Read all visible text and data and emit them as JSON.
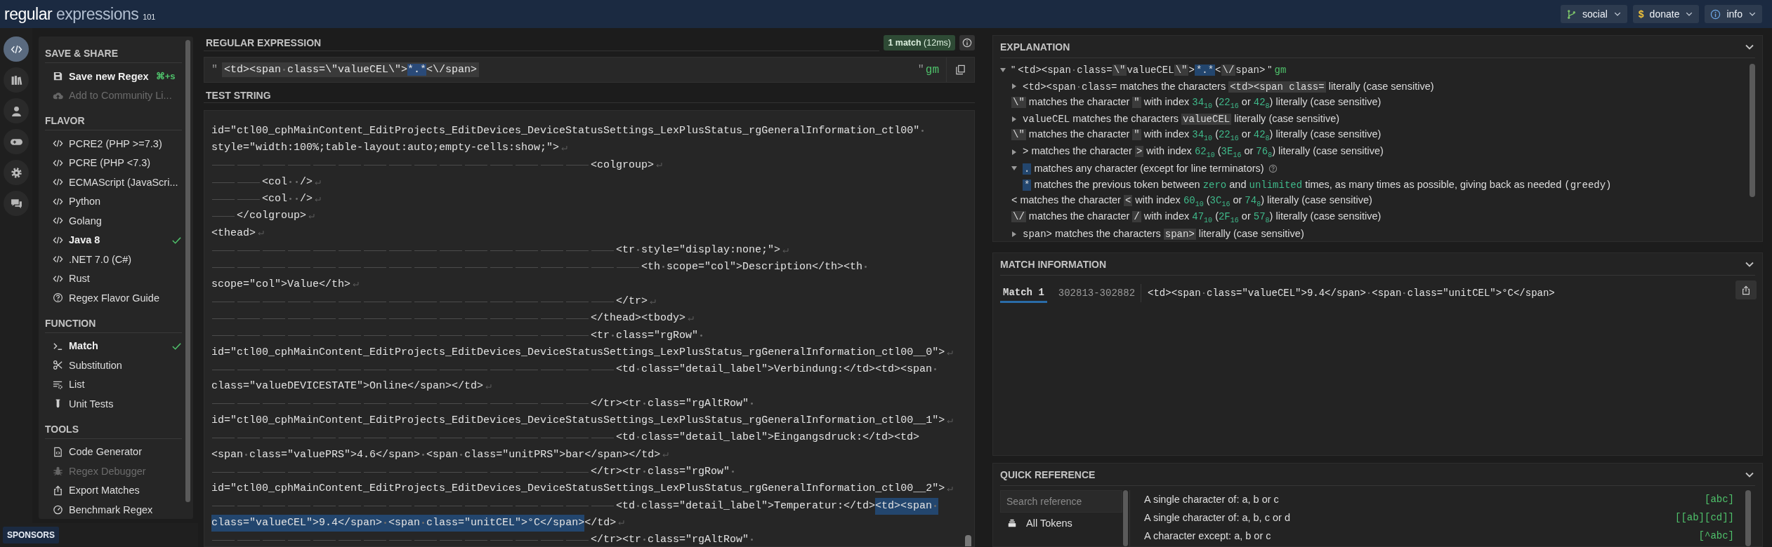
{
  "header": {
    "logo": [
      "regular",
      "expressions",
      "101"
    ],
    "buttons": [
      {
        "label": "social"
      },
      {
        "label": "donate",
        "glyph": "$"
      },
      {
        "label": "info"
      }
    ]
  },
  "rail": [
    {
      "selected": true
    },
    {
      "selected": false
    },
    {
      "selected": false
    },
    {
      "selected": false
    },
    {
      "selected": false
    },
    {
      "selected": false
    }
  ],
  "sidebar": {
    "sections": [
      {
        "title": "SAVE & SHARE",
        "items": [
          {
            "label": "Save new Regex",
            "shortcut": "⌘+s",
            "disabled": false
          },
          {
            "label": "Add to Community Li...",
            "disabled": true
          }
        ]
      },
      {
        "title": "FLAVOR",
        "items": [
          {
            "label": "PCRE2 (PHP >=7.3)",
            "selected": false,
            "disabled": false
          },
          {
            "label": "PCRE (PHP <7.3)",
            "selected": false,
            "disabled": false
          },
          {
            "label": "ECMAScript (JavaScri...",
            "selected": false,
            "disabled": false
          },
          {
            "label": "Python",
            "selected": false,
            "disabled": false
          },
          {
            "label": "Golang",
            "selected": false,
            "disabled": false
          },
          {
            "label": "Java 8",
            "selected": true,
            "disabled": false
          },
          {
            "label": ".NET 7.0 (C#)",
            "selected": false,
            "disabled": false
          },
          {
            "label": "Rust",
            "selected": false,
            "disabled": false
          },
          {
            "label": "Regex Flavor Guide",
            "selected": false,
            "disabled": false
          }
        ]
      },
      {
        "title": "FUNCTION",
        "items": [
          {
            "label": "Match",
            "selected": true,
            "disabled": false
          },
          {
            "label": "Substitution",
            "selected": false,
            "disabled": false
          },
          {
            "label": "List",
            "selected": false,
            "disabled": false
          },
          {
            "label": "Unit Tests",
            "selected": false,
            "disabled": false
          }
        ]
      },
      {
        "title": "TOOLS",
        "items": [
          {
            "label": "Code Generator",
            "selected": false,
            "disabled": false
          },
          {
            "label": "Regex Debugger",
            "selected": false,
            "disabled": true
          },
          {
            "label": "Export Matches",
            "selected": false,
            "disabled": false
          },
          {
            "label": "Benchmark Regex",
            "selected": false,
            "disabled": false
          }
        ]
      }
    ]
  },
  "sponsors": "SPONSORS",
  "regex": {
    "title": "REGULAR EXPRESSION",
    "badge": "**1 match** (12ms)",
    "delimiter_open": "\"",
    "pattern": [
      {
        "kind": "literal",
        "text": "<td><span class=\\\"valueCEL\\\">"
      },
      {
        "kind": "quantifier",
        "text": "*.*"
      },
      {
        "kind": "literal",
        "text": "<\\/span>"
      }
    ],
    "delimiter_close": "\"",
    "flags": "gm"
  },
  "test_string": {
    "title": "TEST STRING",
    "lines": [
      {
        "segments": [
          {
            "text": "id=\"ctl00_cphMainContent_EditProjects_EditDevices_DeviceStatusSettings_LexPlusStatus_rgGeneralInformation_ctl00\" ",
            "match": false
          }
        ],
        "line_break": false
      },
      {
        "segments": [
          {
            "text": "style=\"width:100%;table-layout:auto;empty-cells:show;\">",
            "match": false
          }
        ],
        "line_break": true
      },
      {
        "segments": [
          {
            "text": "\t\t\t\t\t\t\t\t\t\t\t\t\t\t\t<colgroup>",
            "match": false
          }
        ],
        "line_break": true
      },
      {
        "segments": [
          {
            "text": "\t\t<col  />",
            "match": false
          }
        ],
        "line_break": true
      },
      {
        "segments": [
          {
            "text": "\t\t<col  />",
            "match": false
          }
        ],
        "line_break": true
      },
      {
        "segments": [
          {
            "text": "\t</colgroup>",
            "match": false
          }
        ],
        "line_break": true
      },
      {
        "segments": [
          {
            "text": "<thead>",
            "match": false
          }
        ],
        "line_break": true
      },
      {
        "segments": [
          {
            "text": "\t\t\t\t\t\t\t\t\t\t\t\t\t\t\t\t<tr style=\"display:none;\">",
            "match": false
          }
        ],
        "line_break": true
      },
      {
        "segments": [
          {
            "text": "\t\t\t\t\t\t\t\t\t\t\t\t\t\t\t\t\t<th scope=\"col\">Description</th><th ",
            "match": false
          }
        ],
        "line_break": false
      },
      {
        "segments": [
          {
            "text": "scope=\"col\">Value</th>",
            "match": false
          }
        ],
        "line_break": true
      },
      {
        "segments": [
          {
            "text": "\t\t\t\t\t\t\t\t\t\t\t\t\t\t\t\t</tr>",
            "match": false
          }
        ],
        "line_break": true
      },
      {
        "segments": [
          {
            "text": "\t\t\t\t\t\t\t\t\t\t\t\t\t\t\t</thead><tbody>",
            "match": false
          }
        ],
        "line_break": true
      },
      {
        "segments": [
          {
            "text": "\t\t\t\t\t\t\t\t\t\t\t\t\t\t\t<tr class=\"rgRow\" ",
            "match": false
          }
        ],
        "line_break": false
      },
      {
        "segments": [
          {
            "text": "id=\"ctl00_cphMainContent_EditProjects_EditDevices_DeviceStatusSettings_LexPlusStatus_rgGeneralInformation_ctl00__0\">",
            "match": false
          }
        ],
        "line_break": true
      },
      {
        "segments": [
          {
            "text": "\t\t\t\t\t\t\t\t\t\t\t\t\t\t\t\t<td class=\"detail_label\">Verbindung:</td><td><span ",
            "match": false
          }
        ],
        "line_break": false
      },
      {
        "segments": [
          {
            "text": "class=\"valueDEVICESTATE\">Online</span></td>",
            "match": false
          }
        ],
        "line_break": true
      },
      {
        "segments": [
          {
            "text": "\t\t\t\t\t\t\t\t\t\t\t\t\t\t\t</tr><tr class=\"rgAltRow\" ",
            "match": false
          }
        ],
        "line_break": false
      },
      {
        "segments": [
          {
            "text": "id=\"ctl00_cphMainContent_EditProjects_EditDevices_DeviceStatusSettings_LexPlusStatus_rgGeneralInformation_ctl00__1\">",
            "match": false
          }
        ],
        "line_break": true
      },
      {
        "segments": [
          {
            "text": "\t\t\t\t\t\t\t\t\t\t\t\t\t\t\t\t<td class=\"detail_label\">Eingangsdruck:</td><td>",
            "match": false
          }
        ],
        "line_break": false
      },
      {
        "segments": [
          {
            "text": "<span class=\"valuePRS\">4.6</span> <span class=\"unitPRS\">bar</span></td>",
            "match": false
          }
        ],
        "line_break": true
      },
      {
        "segments": [
          {
            "text": "\t\t\t\t\t\t\t\t\t\t\t\t\t\t\t</tr><tr class=\"rgRow\" ",
            "match": false
          }
        ],
        "line_break": false
      },
      {
        "segments": [
          {
            "text": "id=\"ctl00_cphMainContent_EditProjects_EditDevices_DeviceStatusSettings_LexPlusStatus_rgGeneralInformation_ctl00__2\">",
            "match": false
          }
        ],
        "line_break": true
      },
      {
        "segments": [
          {
            "text": "\t\t\t\t\t\t\t\t\t\t\t\t\t\t\t\t<td class=\"detail_label\">Temperatur:</td>",
            "match": false
          },
          {
            "text": "<td><span ",
            "match": true
          }
        ],
        "line_break": false
      },
      {
        "segments": [
          {
            "text": "class=\"valueCEL\">9.4</span> <span class=\"unitCEL\">°C</span>",
            "match": true
          },
          {
            "text": "</td>",
            "match": false
          }
        ],
        "line_break": true
      },
      {
        "segments": [
          {
            "text": "\t\t\t\t\t\t\t\t\t\t\t\t\t\t\t</tr><tr class=\"rgAltRow\" ",
            "match": false
          }
        ],
        "line_break": false
      }
    ]
  },
  "explanation": {
    "title": "EXPLANATION",
    "rows": [
      {
        "expanded": true,
        "parts": [
          {
            "kind": "text",
            "text": "\" "
          },
          {
            "kind": "token",
            "text": "<td><span class="
          },
          {
            "kind": "code",
            "text": "\\\""
          },
          {
            "kind": "token",
            "text": "valueCEL"
          },
          {
            "kind": "code",
            "text": "\\\""
          },
          {
            "kind": "token",
            "text": ">"
          },
          {
            "kind": "hl",
            "text": "*.*"
          },
          {
            "kind": "token",
            "text": "<"
          },
          {
            "kind": "code",
            "text": "\\/"
          },
          {
            "kind": "token",
            "text": "span>"
          },
          {
            "kind": "text",
            "text": " \" "
          },
          {
            "kind": "flag",
            "text": "gm"
          }
        ],
        "children": [
          {
            "expanded": false,
            "parts": [
              {
                "kind": "token",
                "text": "<td><span class="
              },
              {
                "kind": "text",
                "text": " matches the characters "
              },
              {
                "kind": "code",
                "text": "<td><span class="
              },
              {
                "kind": "text",
                "text": " literally (case sensitive)"
              }
            ]
          },
          {
            "parts": [
              {
                "kind": "code",
                "text": "\\\""
              },
              {
                "kind": "text",
                "text": " matches the character "
              },
              {
                "kind": "code",
                "text": "\""
              },
              {
                "kind": "text",
                "text": " with index "
              },
              {
                "kind": "num",
                "text": "34$_{10}$"
              },
              {
                "kind": "text",
                "text": " ("
              },
              {
                "kind": "num",
                "text": "22$_{16}$"
              },
              {
                "kind": "text",
                "text": " or "
              },
              {
                "kind": "num",
                "text": "42$_{8}$"
              },
              {
                "kind": "text",
                "text": ") literally (case sensitive)"
              }
            ]
          },
          {
            "expanded": false,
            "parts": [
              {
                "kind": "token",
                "text": "valueCEL"
              },
              {
                "kind": "text",
                "text": " matches the characters "
              },
              {
                "kind": "code",
                "text": "valueCEL"
              },
              {
                "kind": "text",
                "text": " literally (case sensitive)"
              }
            ]
          },
          {
            "parts": [
              {
                "kind": "code",
                "text": "\\\""
              },
              {
                "kind": "text",
                "text": " matches the character "
              },
              {
                "kind": "code",
                "text": "\""
              },
              {
                "kind": "text",
                "text": " with index "
              },
              {
                "kind": "num",
                "text": "34$_{10}$"
              },
              {
                "kind": "text",
                "text": " ("
              },
              {
                "kind": "num",
                "text": "22$_{16}$"
              },
              {
                "kind": "text",
                "text": " or "
              },
              {
                "kind": "num",
                "text": "42$_{8}$"
              },
              {
                "kind": "text",
                "text": ") literally (case sensitive)"
              }
            ]
          },
          {
            "expanded": false,
            "parts": [
              {
                "kind": "token",
                "text": ">"
              },
              {
                "kind": "text",
                "text": " matches the character "
              },
              {
                "kind": "code",
                "text": ">"
              },
              {
                "kind": "text",
                "text": " with index "
              },
              {
                "kind": "num",
                "text": "62$_{10}$"
              },
              {
                "kind": "text",
                "text": " ("
              },
              {
                "kind": "num",
                "text": "3E$_{16}$"
              },
              {
                "kind": "text",
                "text": " or "
              },
              {
                "kind": "num",
                "text": "76$_{8}$"
              },
              {
                "kind": "text",
                "text": ") literally (case sensitive)"
              }
            ]
          },
          {
            "expanded": true,
            "help": true,
            "parts": [
              {
                "kind": "hl",
                "text": "."
              },
              {
                "kind": "text",
                "text": " matches any character (except for line terminators)"
              }
            ],
            "children": [
              {
                "parts": [
                  {
                    "kind": "hl",
                    "text": "*"
                  },
                  {
                    "kind": "text",
                    "text": " matches the previous token between "
                  },
                  {
                    "kind": "num",
                    "text": "zero"
                  },
                  {
                    "kind": "text",
                    "text": " and "
                  },
                  {
                    "kind": "num",
                    "text": "unlimited"
                  },
                  {
                    "kind": "text",
                    "text": " times, as many times as possible, giving back as needed "
                  },
                  {
                    "kind": "token",
                    "text": "(greedy)"
                  }
                ]
              }
            ]
          },
          {
            "parts": [
              {
                "kind": "token",
                "text": "<"
              },
              {
                "kind": "text",
                "text": " matches the character "
              },
              {
                "kind": "code",
                "text": "<"
              },
              {
                "kind": "text",
                "text": " with index "
              },
              {
                "kind": "num",
                "text": "60$_{10}$"
              },
              {
                "kind": "text",
                "text": " ("
              },
              {
                "kind": "num",
                "text": "3C$_{16}$"
              },
              {
                "kind": "text",
                "text": " or "
              },
              {
                "kind": "num",
                "text": "74$_{8}$"
              },
              {
                "kind": "text",
                "text": ") literally (case sensitive)"
              }
            ]
          },
          {
            "parts": [
              {
                "kind": "code",
                "text": "\\/"
              },
              {
                "kind": "text",
                "text": " matches the character "
              },
              {
                "kind": "code",
                "text": "/"
              },
              {
                "kind": "text",
                "text": " with index "
              },
              {
                "kind": "num",
                "text": "47$_{10}$"
              },
              {
                "kind": "text",
                "text": " ("
              },
              {
                "kind": "num",
                "text": "2F$_{16}$"
              },
              {
                "kind": "text",
                "text": " or "
              },
              {
                "kind": "num",
                "text": "57$_{8}$"
              },
              {
                "kind": "text",
                "text": ") literally (case sensitive)"
              }
            ]
          },
          {
            "expanded": false,
            "parts": [
              {
                "kind": "token",
                "text": "span>"
              },
              {
                "kind": "text",
                "text": " matches the characters "
              },
              {
                "kind": "code",
                "text": "span>"
              },
              {
                "kind": "text",
                "text": " literally (case sensitive)"
              }
            ]
          }
        ]
      }
    ]
  },
  "match_information": {
    "title": "MATCH INFORMATION",
    "matches": [
      {
        "label": "Match 1",
        "selected": true,
        "range": "302813-302882",
        "text": "<td><span class=\"valueCEL\">9.4</span> <span class=\"unitCEL\">°C</span>"
      }
    ]
  },
  "quick_reference": {
    "title": "QUICK REFERENCE",
    "search": {
      "placeholder": "Search reference"
    },
    "categories": [
      {
        "label": "All Tokens"
      }
    ],
    "entries": [
      {
        "description": "A single character of: a, b or c",
        "token": "[abc]"
      },
      {
        "description": "A single character of: a, b, c or d",
        "token": "[[ab][cd]]"
      },
      {
        "description": "A character except: a, b or c",
        "token": "[^abc]"
      }
    ]
  }
}
